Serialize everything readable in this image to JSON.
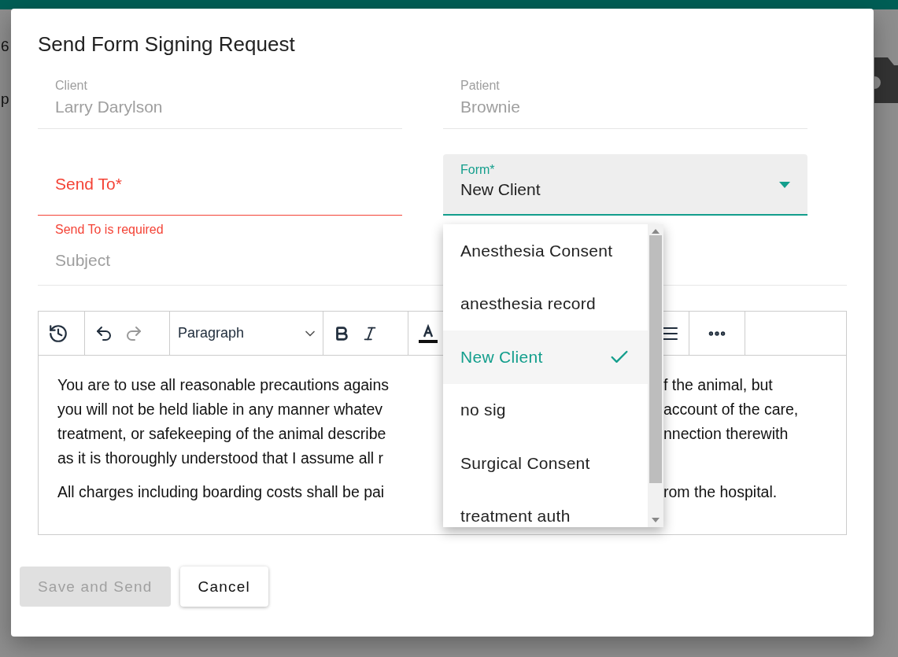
{
  "background": {
    "fragments": [
      "6",
      "p"
    ]
  },
  "dialog": {
    "title": "Send Form Signing Request",
    "client": {
      "label": "Client",
      "value": "Larry Darylson",
      "disabled": true
    },
    "patient": {
      "label": "Patient",
      "value": "Brownie",
      "disabled": true
    },
    "send_to": {
      "label": "Send To*",
      "error": "Send To is required",
      "invalid": true
    },
    "form": {
      "label": "Form*",
      "value": "New Client",
      "expanded": true
    },
    "subject": {
      "placeholder": "Subject"
    },
    "toolbar": {
      "block_format": "Paragraph",
      "redo_disabled": true
    },
    "editor": {
      "paragraphs": [
        {
          "lines": [
            {
              "segments": [
                "You are to use all reasonable precautions agains",
                "f the animal, but"
              ]
            },
            {
              "segments": [
                "you will not be held liable in any manner whatev",
                "account of the care,"
              ]
            },
            {
              "segments": [
                "treatment, or safekeeping of the animal describe",
                "nnection therewith"
              ]
            },
            {
              "segments": [
                "as it is thoroughly understood that I assume all r"
              ]
            }
          ]
        },
        {
          "lines": [
            {
              "segments": [
                "All charges including boarding costs shall be pai",
                "rom the hospital."
              ]
            }
          ]
        }
      ]
    },
    "buttons": [
      {
        "label": "Save and Send",
        "kind": "primary",
        "disabled": true
      },
      {
        "label": "Cancel",
        "kind": "secondary",
        "disabled": false
      }
    ]
  },
  "form_menu": {
    "items": [
      {
        "label": "Anesthesia Consent",
        "selected": false
      },
      {
        "label": "anesthesia record",
        "selected": false
      },
      {
        "label": "New Client",
        "selected": true
      },
      {
        "label": "no sig",
        "selected": false
      },
      {
        "label": "Surgical Consent",
        "selected": false
      },
      {
        "label": "treatment auth",
        "selected": false
      }
    ]
  }
}
